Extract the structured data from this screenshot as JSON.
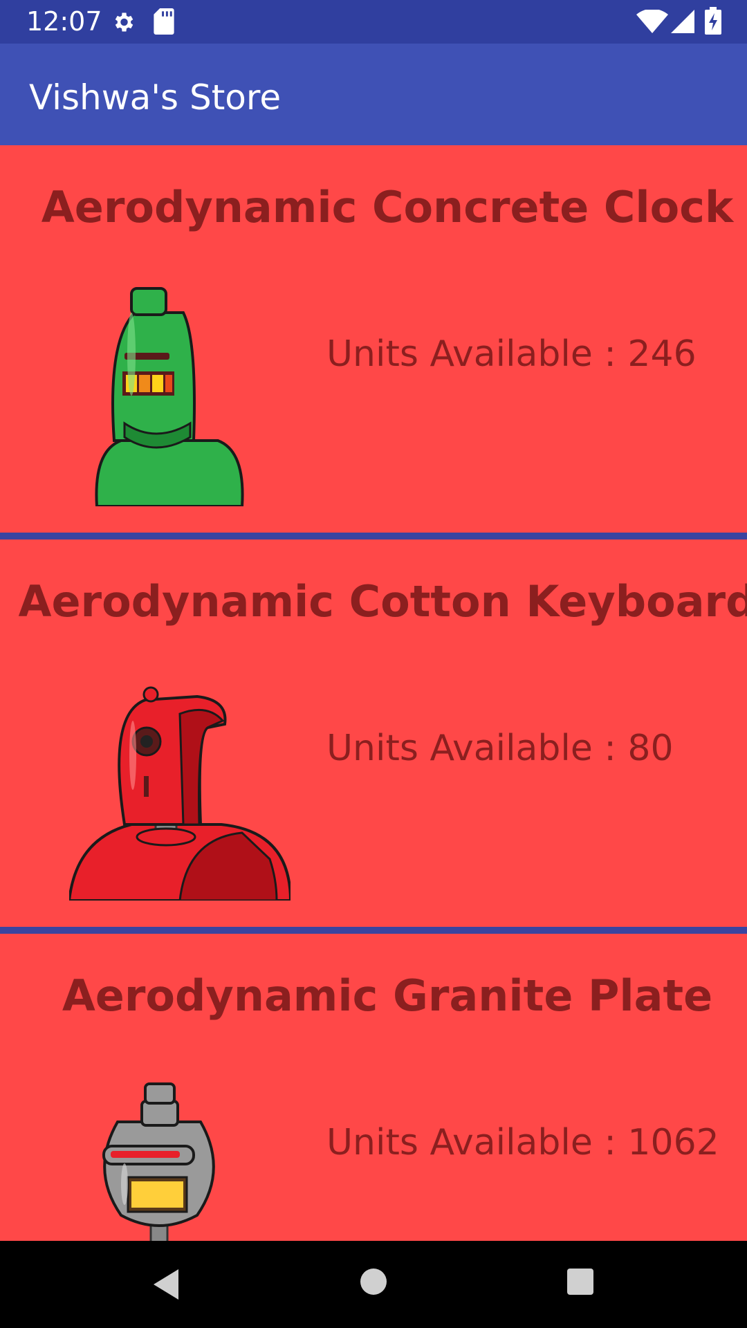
{
  "status_bar": {
    "time": "12:07",
    "icons": [
      "settings-icon",
      "sd-card-icon",
      "wifi-icon",
      "signal-icon",
      "battery-charging-icon"
    ]
  },
  "app_bar": {
    "title": "Vishwa's Store"
  },
  "products": [
    {
      "name": "Aerodynamic Concrete Clock",
      "units": "Units Available : 246",
      "image": "green-robot-image",
      "color": "#2fb14a"
    },
    {
      "name": "Aerodynamic Cotton Keyboard",
      "units": "Units Available : 80",
      "image": "red-robot-image",
      "color": "#e8202a"
    },
    {
      "name": "Aerodynamic Granite Plate",
      "units": "Units Available : 1062",
      "image": "gray-robot-image",
      "color": "#9a9a9a"
    }
  ],
  "colors": {
    "status_bar": "#303f9f",
    "app_bar": "#3f51b5",
    "card_background": "#ff4848",
    "card_text": "#8b1f1f",
    "divider": "#3a44a0"
  },
  "nav_bar": {
    "icons": [
      "back-icon",
      "home-icon",
      "recents-icon"
    ]
  }
}
